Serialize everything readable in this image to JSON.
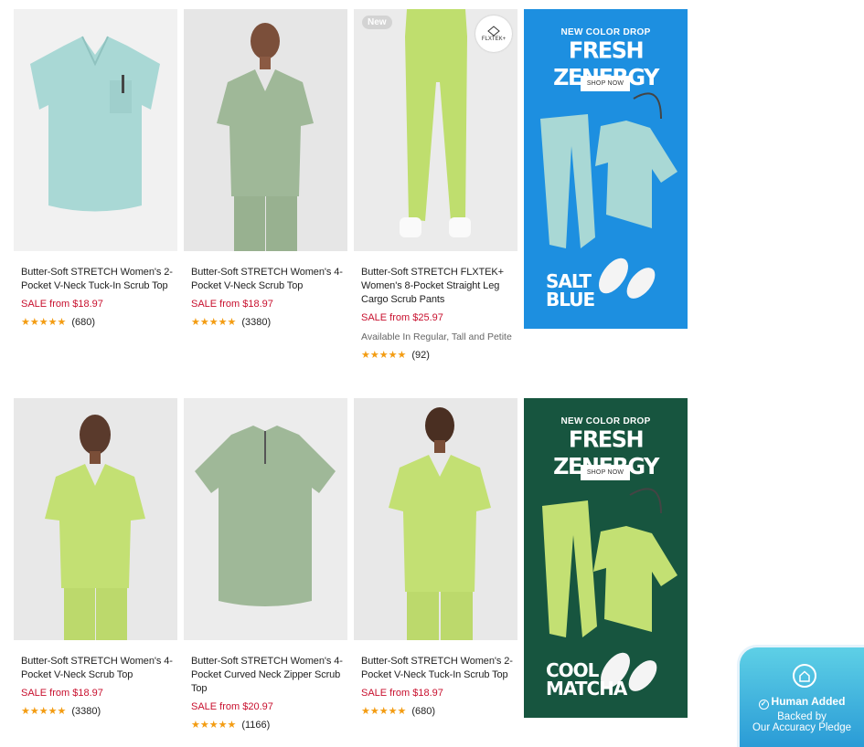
{
  "products": [
    {
      "title": "Butter-Soft STRETCH Women's 2-Pocket V-Neck Tuck-In Scrub Top",
      "price": "SALE from $18.97",
      "stars": "★★★★★",
      "count": "(680)",
      "color": "#a9d8d5"
    },
    {
      "title": "Butter-Soft STRETCH Women's 4-Pocket V-Neck Scrub Top",
      "price": "SALE from $18.97",
      "stars": "★★★★★",
      "count": "(3380)",
      "color": "#9fb898"
    },
    {
      "title": "Butter-Soft STRETCH FLXTEK+ Women's 8-Pocket Straight Leg Cargo Scrub Pants",
      "price": "SALE from $25.97",
      "availability": "Available In Regular, Tall and Petite",
      "badge": "New",
      "feature_badge": "FLXTEK+",
      "stars": "★★★★★",
      "count": "(92)",
      "color": "#bfde6e"
    },
    {
      "title": "Butter-Soft STRETCH Women's 4-Pocket V-Neck Scrub Top",
      "price": "SALE from $18.97",
      "stars": "★★★★★",
      "count": "(3380)",
      "color": "#c3e073"
    },
    {
      "title": "Butter-Soft STRETCH Women's 4-Pocket Curved Neck Zipper Scrub Top",
      "price": "SALE from $20.97",
      "stars": "★★★★★",
      "count": "(1166)",
      "color": "#9fb898"
    },
    {
      "title": "Butter-Soft STRETCH Women's 2-Pocket V-Neck Tuck-In Scrub Top",
      "price": "SALE from $18.97",
      "stars": "★★★★★",
      "count": "(680)",
      "color": "#c3e073"
    }
  ],
  "promos": [
    {
      "eyebrow": "NEW COLOR DROP",
      "headline": "FRESH ZENERGY",
      "cta": "SHOP NOW",
      "color_name": "SALT\nBLUE",
      "bg": "#1d8fe0"
    },
    {
      "eyebrow": "NEW COLOR DROP",
      "headline": "FRESH ZENERGY",
      "cta": "SHOP NOW",
      "color_name": "COOL\nMATCHA",
      "bg": "#17553f"
    }
  ],
  "pledge": {
    "title": "Human Added",
    "line1": "Backed by",
    "line2": "Our Accuracy Pledge"
  }
}
